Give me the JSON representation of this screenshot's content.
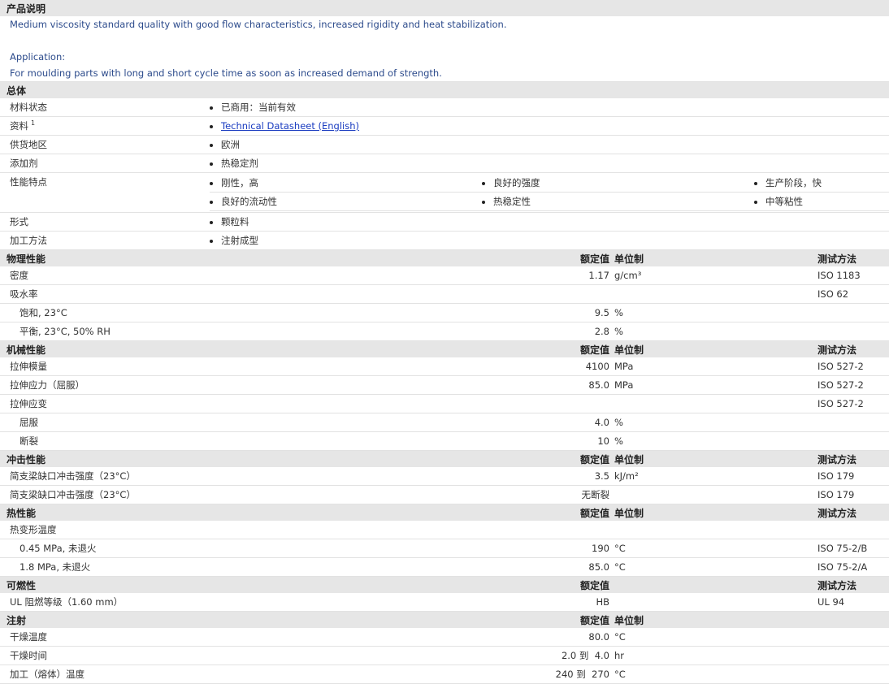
{
  "desc": {
    "heading": "产品说明",
    "line1": "Medium viscosity standard quality with good flow characteristics, increased rigidity and heat stabilization.",
    "app_label": "Application:",
    "app_text": "For moulding parts with long and short cycle time as soon as increased demand of strength."
  },
  "general": {
    "heading": "总体",
    "rows": [
      {
        "label": "材料状态",
        "value": "已商用：当前有效"
      },
      {
        "label": "资料",
        "sup": "1",
        "value": "Technical Datasheet (English)"
      },
      {
        "label": "供货地区",
        "value": "欧洲"
      },
      {
        "label": "添加剂",
        "value": "热稳定剂"
      },
      {
        "label": "性能特点",
        "features": [
          "刚性，高",
          "良好的强度",
          "生产阶段，快",
          "良好的流动性",
          "热稳定性",
          "中等粘性"
        ]
      },
      {
        "label": "形式",
        "value": "颗粒料"
      },
      {
        "label": "加工方法",
        "value": "注射成型"
      }
    ]
  },
  "col": {
    "nominal": "额定值",
    "unit": "单位制",
    "method": "测试方法"
  },
  "physical": {
    "heading": "物理性能",
    "rows": [
      {
        "label": "密度",
        "value": "1.17",
        "unit": "g/cm³",
        "method": "ISO 1183"
      },
      {
        "label": "吸水率",
        "value": "",
        "unit": "",
        "method": "ISO 62"
      },
      {
        "label": "饱和, 23°C",
        "value": "9.5",
        "unit": "%",
        "method": ""
      },
      {
        "label": "平衡, 23°C, 50% RH",
        "value": "2.8",
        "unit": "%",
        "method": ""
      }
    ]
  },
  "mechanical": {
    "heading": "机械性能",
    "rows": [
      {
        "label": "拉伸模量",
        "value": "4100",
        "unit": "MPa",
        "method": "ISO 527-2"
      },
      {
        "label": "拉伸应力（屈服）",
        "value": "85.0",
        "unit": "MPa",
        "method": "ISO 527-2"
      },
      {
        "label": "拉伸应变",
        "value": "",
        "unit": "",
        "method": "ISO 527-2"
      },
      {
        "label": "屈服",
        "value": "4.0",
        "unit": "%",
        "method": ""
      },
      {
        "label": "断裂",
        "value": "10",
        "unit": "%",
        "method": ""
      }
    ]
  },
  "impact": {
    "heading": "冲击性能",
    "rows": [
      {
        "label": "简支梁缺口冲击强度（23°C）",
        "value": "3.5",
        "unit": "kJ/m²",
        "method": "ISO 179"
      },
      {
        "label": "简支梁缺口冲击强度（23°C）",
        "value": "无断裂",
        "unit": "",
        "method": "ISO 179"
      }
    ]
  },
  "thermal": {
    "heading": "热性能",
    "rows": [
      {
        "label": "热变形温度",
        "value": "",
        "unit": "",
        "method": ""
      },
      {
        "label": "0.45 MPa, 未退火",
        "value": "190",
        "unit": "°C",
        "method": "ISO 75-2/B"
      },
      {
        "label": "1.8 MPa, 未退火",
        "value": "85.0",
        "unit": "°C",
        "method": "ISO 75-2/A"
      }
    ]
  },
  "flammability": {
    "heading": "可燃性",
    "rows": [
      {
        "label": "UL 阻燃等级（1.60 mm）",
        "value": "HB",
        "unit": "",
        "method": "UL 94"
      }
    ]
  },
  "injection": {
    "heading": "注射",
    "rows": [
      {
        "label": "干燥温度",
        "value": "80.0",
        "unit": "°C",
        "method": ""
      },
      {
        "label": "干燥时间",
        "value": "2.0 到  4.0",
        "unit": "hr",
        "method": ""
      },
      {
        "label": "加工（熔体）温度",
        "value": "240 到  270",
        "unit": "°C",
        "method": ""
      }
    ]
  }
}
